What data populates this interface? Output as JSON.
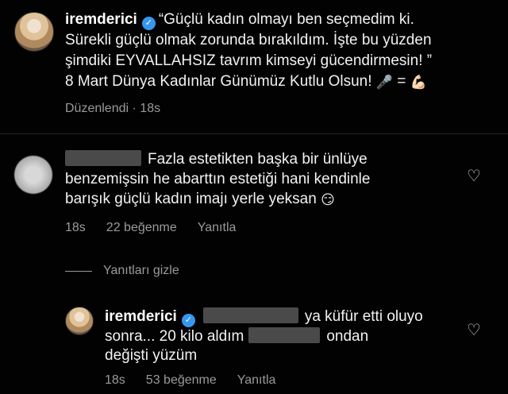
{
  "post": {
    "username": "iremderici",
    "caption_line1": "“Güçlü kadın olmayı ben seçmedim ki.",
    "caption_line2": "Sürekli güçlü olmak zorunda bırakıldım. İşte bu yüzden",
    "caption_line3": "şimdiki EYVALLAHSIZ tavrım kimseyi gücendirmesin! ”",
    "caption_line4": "8 Mart Dünya Kadınlar Günümüz Kutlu Olsun!",
    "emoji_mic": "🎤",
    "equals": "=",
    "emoji_muscle": "💪🏻",
    "edited": "Düzenlendi",
    "separator": "·",
    "time": "18s"
  },
  "comment": {
    "line1": "Fazla estetikten başka bir ünlüye",
    "line2": "benzemişsin he abarttın estetiği hani kendinle",
    "line3": "barışık güçlü kadın imajı yerle yeksan",
    "emoji": "😏",
    "time": "18s",
    "likes": "22 beğenme",
    "reply_label": "Yanıtla"
  },
  "hide_replies": "Yanıtları gizle",
  "reply": {
    "username": "iremderici",
    "text_a": "ya küfür etti oluyo",
    "text_b": "sonra... 20 kilo aldım",
    "text_c": "ondan",
    "text_d": "değişti yüzüm",
    "time": "18s",
    "likes": "53 beğenme",
    "reply_label": "Yanıtla"
  },
  "icons": {
    "verified": "verified-badge-icon",
    "heart": "heart-outline-icon",
    "verified_color": "#3797f0"
  }
}
